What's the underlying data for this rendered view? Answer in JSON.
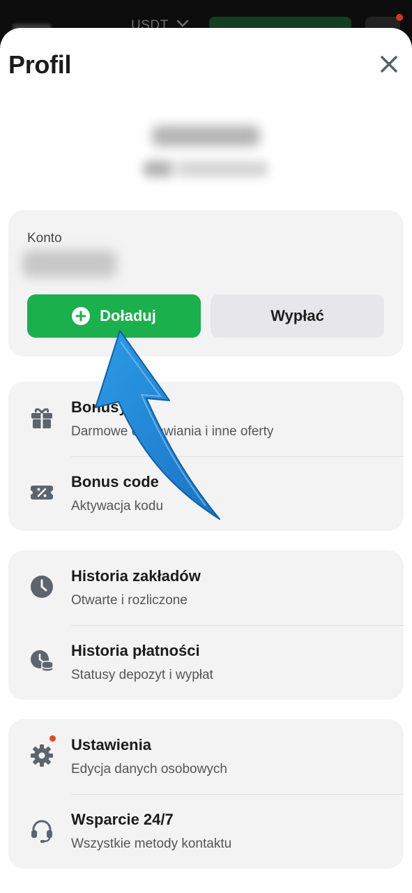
{
  "topbar": {
    "currency": "USDT",
    "notification_badge_color": "#d8361b"
  },
  "profile": {
    "title": "Profil",
    "close_icon": "close-icon",
    "username": "",
    "user_id": ""
  },
  "account": {
    "label": "Konto",
    "balance": "",
    "deposit_label": "Doładuj",
    "withdraw_label": "Wypłać",
    "accent_color": "#1ab04c"
  },
  "menu": {
    "group1": [
      {
        "title": "Bonusy",
        "subtitle": "Darmowe obstawiania i inne oferty",
        "icon": "gift-icon"
      },
      {
        "title": "Bonus code",
        "subtitle": "Aktywacja kodu",
        "icon": "coupon-icon"
      }
    ],
    "group2": [
      {
        "title": "Historia zakładów",
        "subtitle": "Otwarte i rozliczone",
        "icon": "clock-icon"
      },
      {
        "title": "Historia płatności",
        "subtitle": "Statusy depozyt i wypłat",
        "icon": "clock-coins-icon"
      }
    ],
    "group3": [
      {
        "title": "Ustawienia",
        "subtitle": "Edycja danych osobowych",
        "icon": "gear-icon"
      },
      {
        "title": "Wsparcie 24/7",
        "subtitle": "Wszystkie metody kontaktu",
        "icon": "headset-icon"
      }
    ]
  },
  "overlay": {
    "arrow_color": "#1f86d4"
  }
}
